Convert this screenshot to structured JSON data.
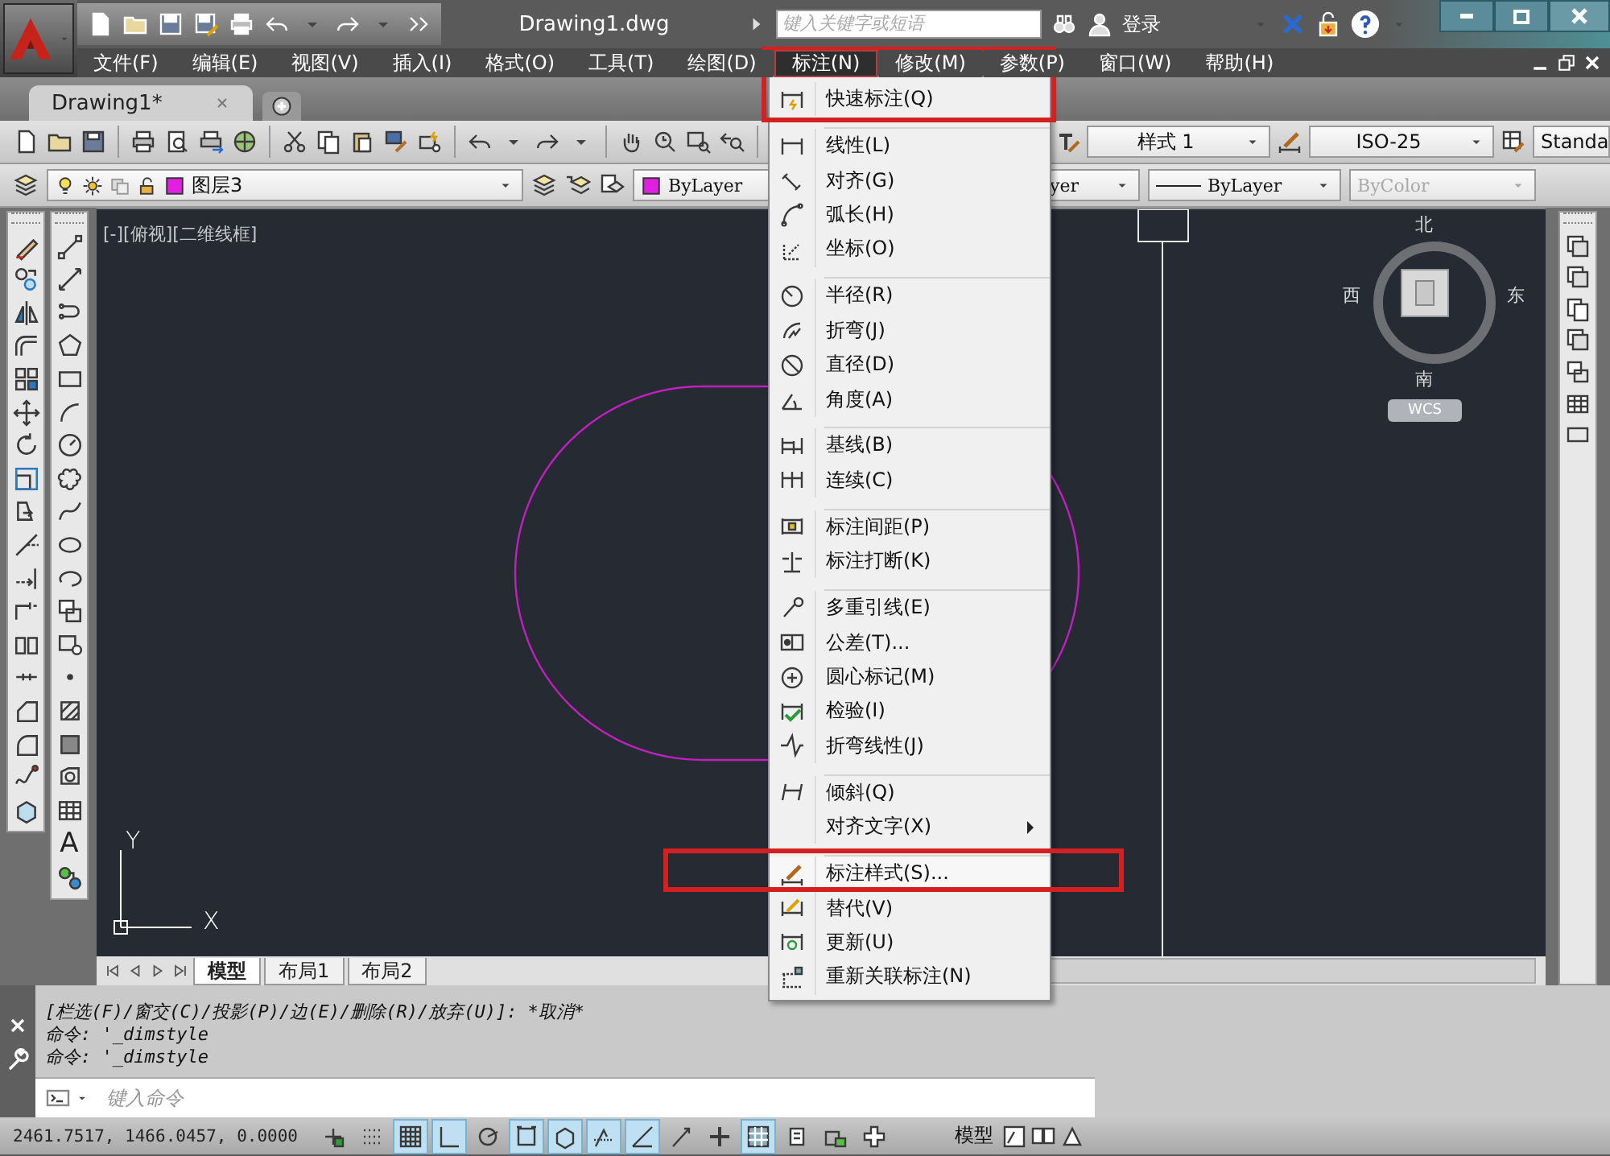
{
  "title_bar": {
    "document_title": "Drawing1.dwg",
    "search": {
      "placeholder": "键入关键字或短语"
    },
    "sign_in": "登录"
  },
  "menu_bar": [
    {
      "label": "文件(F)",
      "selected": false,
      "highlighted": false
    },
    {
      "label": "编辑(E)",
      "selected": false,
      "highlighted": false
    },
    {
      "label": "视图(V)",
      "selected": false,
      "highlighted": false
    },
    {
      "label": "插入(I)",
      "selected": false,
      "highlighted": false
    },
    {
      "label": "格式(O)",
      "selected": false,
      "highlighted": false
    },
    {
      "label": "工具(T)",
      "selected": false,
      "highlighted": false
    },
    {
      "label": "绘图(D)",
      "selected": false,
      "highlighted": false
    },
    {
      "label": "标注(N)",
      "selected": true,
      "highlighted": true
    },
    {
      "label": "修改(M)",
      "selected": false,
      "highlighted": false
    },
    {
      "label": "参数(P)",
      "selected": false,
      "highlighted": false
    },
    {
      "label": "窗口(W)",
      "selected": false,
      "highlighted": false
    },
    {
      "label": "帮助(H)",
      "selected": false,
      "highlighted": false
    }
  ],
  "file_tabs": [
    {
      "label": "Drawing1*",
      "selected": true
    }
  ],
  "style_toolbar": {
    "text_style": "样式 1",
    "dim_style": "ISO-25",
    "table_style": "Standa"
  },
  "layer_toolbar": {
    "layer": "图层3",
    "color_control": "ByLayer",
    "linetype": "yer",
    "lineweight": "ByLayer",
    "plot_style": {
      "value": "ByColor",
      "disabled": true
    }
  },
  "draw_toolbar": {
    "text_tool": "A"
  },
  "viewport": {
    "label": "[-][俯视][二维线框]",
    "compass": {
      "north": "北",
      "west": "西",
      "east": "东",
      "south": "南",
      "ucs_button": "WCS"
    },
    "ucs": {
      "x": "X",
      "y": "Y"
    }
  },
  "layout_tabs": [
    {
      "label": "模型",
      "selected": true
    },
    {
      "label": "布局1",
      "selected": false
    },
    {
      "label": "布局2",
      "selected": false
    }
  ],
  "dim_menu": {
    "items": [
      {
        "kind": "item",
        "label": "快速标注(Q)",
        "highlighted": false
      },
      {
        "kind": "separator"
      },
      {
        "kind": "item",
        "label": "线性(L)",
        "highlighted": false
      },
      {
        "kind": "item",
        "label": "对齐(G)",
        "highlighted": false
      },
      {
        "kind": "item",
        "label": "弧长(H)",
        "highlighted": false
      },
      {
        "kind": "item",
        "label": "坐标(O)",
        "highlighted": false
      },
      {
        "kind": "separator"
      },
      {
        "kind": "item",
        "label": "半径(R)",
        "highlighted": false
      },
      {
        "kind": "item",
        "label": "折弯(J)",
        "highlighted": false
      },
      {
        "kind": "item",
        "label": "直径(D)",
        "highlighted": false
      },
      {
        "kind": "item",
        "label": "角度(A)",
        "highlighted": false
      },
      {
        "kind": "separator"
      },
      {
        "kind": "item",
        "label": "基线(B)",
        "highlighted": false
      },
      {
        "kind": "item",
        "label": "连续(C)",
        "highlighted": false
      },
      {
        "kind": "separator"
      },
      {
        "kind": "item",
        "label": "标注间距(P)",
        "highlighted": false
      },
      {
        "kind": "item",
        "label": "标注打断(K)",
        "highlighted": false
      },
      {
        "kind": "separator"
      },
      {
        "kind": "item",
        "label": "多重引线(E)",
        "highlighted": false
      },
      {
        "kind": "item",
        "label": "公差(T)...",
        "highlighted": false
      },
      {
        "kind": "item",
        "label": "圆心标记(M)",
        "highlighted": false
      },
      {
        "kind": "item",
        "label": "检验(I)",
        "highlighted": false
      },
      {
        "kind": "item",
        "label": "折弯线性(J)",
        "highlighted": false
      },
      {
        "kind": "separator"
      },
      {
        "kind": "item",
        "label": "倾斜(Q)",
        "highlighted": false
      },
      {
        "kind": "submenu",
        "label": "对齐文字(X)",
        "highlighted": false
      },
      {
        "kind": "separator"
      },
      {
        "kind": "item",
        "label": "标注样式(S)...",
        "highlighted": true
      },
      {
        "kind": "item",
        "label": "替代(V)",
        "highlighted": false
      },
      {
        "kind": "item",
        "label": "更新(U)",
        "highlighted": false
      },
      {
        "kind": "item",
        "label": "重新关联标注(N)",
        "highlighted": false
      }
    ]
  },
  "command_line": {
    "history": [
      "[栏选(F)/窗交(C)/投影(P)/边(E)/删除(R)/放弃(U)]: *取消*",
      "命令: '_dimstyle",
      "命令: '_dimstyle"
    ],
    "input": {
      "placeholder": "键入命令"
    }
  },
  "status_bar": {
    "coordinates": "2461.7517, 1466.0457, 0.0000",
    "toggles": [
      {
        "on": false
      },
      {
        "on": false
      },
      {
        "on": true
      },
      {
        "on": true
      },
      {
        "on": false
      },
      {
        "on": true
      },
      {
        "on": true
      },
      {
        "on": true
      },
      {
        "on": true
      },
      {
        "on": false
      },
      {
        "on": false
      },
      {
        "on": true
      },
      {
        "on": false
      },
      {
        "on": false
      },
      {
        "on": false
      }
    ],
    "space": "模型"
  }
}
